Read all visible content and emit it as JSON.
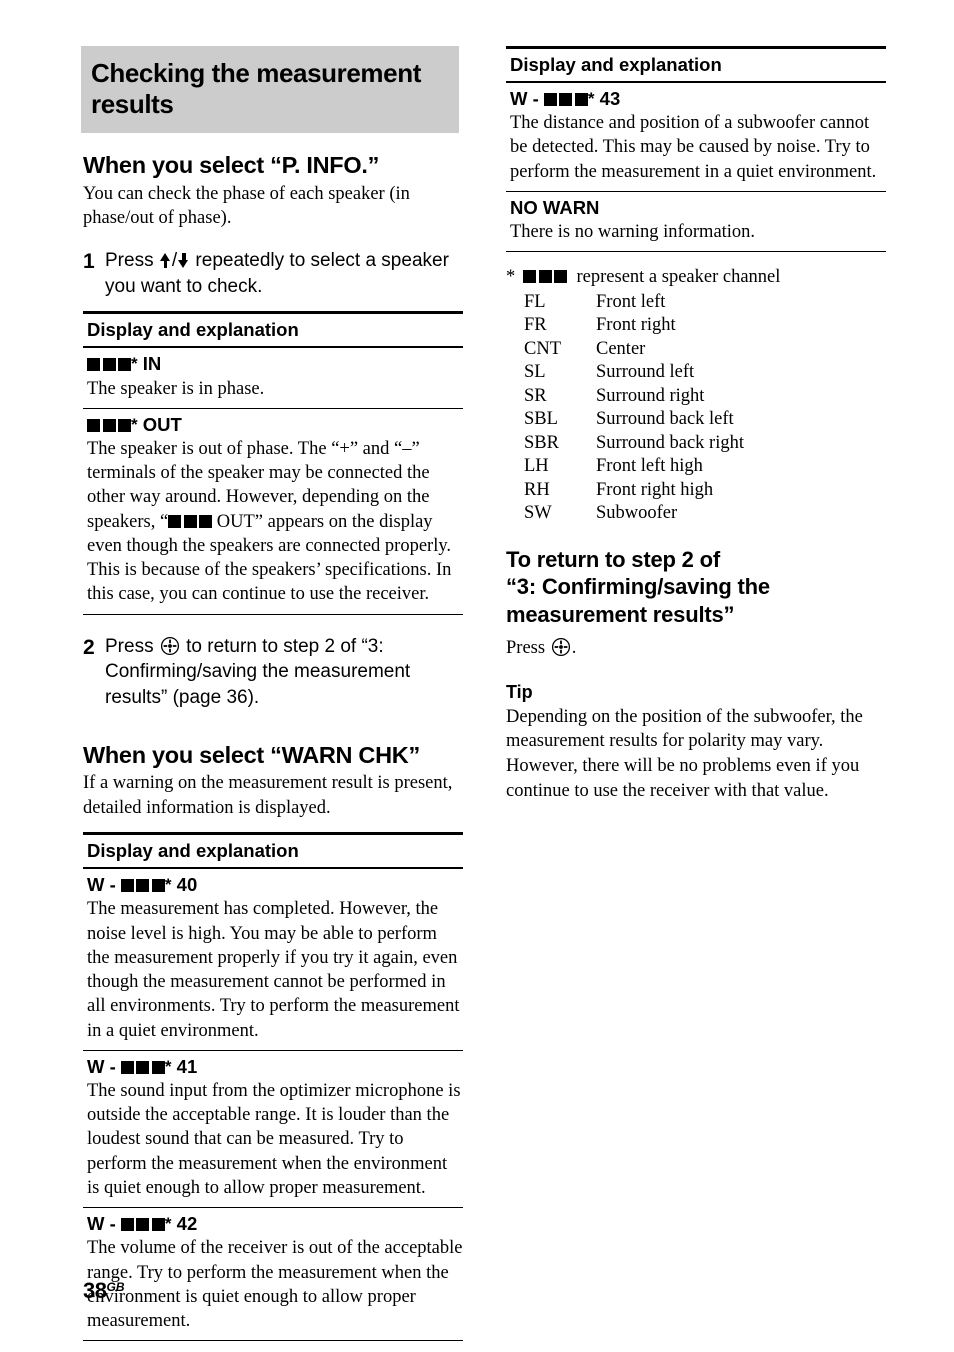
{
  "page": {
    "folio_number": "38",
    "folio_suffix": "GB"
  },
  "banner": {
    "title": "Checking the measurement results"
  },
  "left_column": {
    "section_pinfo": {
      "heading": "When you select “P. INFO.”",
      "intro": "You can check the phase of each speaker (in phase/out of phase).",
      "steps": [
        {
          "number": "1",
          "text_before": "Press ",
          "icon_1": "arrow-up-icon",
          "separator": "/",
          "icon_2": "arrow-down-icon",
          "text_after": " repeatedly to select a speaker you want to check."
        },
        {
          "number": "2",
          "text_before": "Press ",
          "icon_1": "enter-button-icon",
          "text_after": " to return to step 2 of “3: Confirming/saving the measurement results” (page 36)."
        }
      ],
      "table": {
        "header": "Display and explanation",
        "rows": [
          {
            "code_squares": 3,
            "code_star": "*",
            "code_suffix": "IN",
            "text": "The speaker is in phase."
          },
          {
            "code_squares": 3,
            "code_star": "*",
            "code_suffix": "OUT",
            "text_part_1": "The speaker is out of phase. The “+” and “–” terminals of the speaker may be connected the other way around. However, depending on the speakers, “",
            "inline_squares": 3,
            "text_part_2": " OUT” appears on the display even though the speakers are connected properly. This is because of the speakers’ specifications. In this case, you can continue to use the receiver."
          }
        ]
      }
    },
    "section_warnchk": {
      "heading": "When you select “WARN CHK”",
      "intro": "If a warning on the measurement result is present, detailed information is displayed.",
      "table": {
        "header": "Display and explanation",
        "rows": [
          {
            "code_prefix": "W - ",
            "code_squares": 3,
            "code_star": "*",
            "code_suffix": "40",
            "text": "The measurement has completed. However, the noise level is high. You may be able to perform the measurement properly if you try it again, even though the measurement cannot be performed in all environments. Try to perform the measurement in a quiet environment."
          },
          {
            "code_prefix": "W - ",
            "code_squares": 3,
            "code_star": "*",
            "code_suffix": "41",
            "text": "The sound input from the optimizer microphone is outside the acceptable range. It is louder than the loudest sound that can be measured. Try to perform the measurement when the environment is quiet enough to allow proper measurement."
          },
          {
            "code_prefix": "W - ",
            "code_squares": 3,
            "code_star": "*",
            "code_suffix": "42",
            "text": "The volume of the receiver is out of the acceptable range. Try to perform the measurement when the environment is quiet enough to allow proper measurement."
          }
        ]
      }
    }
  },
  "right_column": {
    "table": {
      "header": "Display and explanation",
      "rows": [
        {
          "code_prefix": "W - ",
          "code_squares": 3,
          "code_star": "*",
          "code_suffix": "43",
          "text": "The distance and position of a subwoofer cannot be detected. This may be caused by noise. Try to perform the measurement in a quiet environment."
        },
        {
          "code_prefix": "",
          "code_squares": 0,
          "code_star": "",
          "code_suffix": "NO WARN",
          "text": "There is no warning information."
        }
      ]
    },
    "legend": {
      "footnote_marker": "*",
      "footnote_squares": 3,
      "footnote_text": "represent a speaker channel",
      "channels": [
        {
          "abbr": "FL",
          "name": "Front left"
        },
        {
          "abbr": "FR",
          "name": "Front right"
        },
        {
          "abbr": "CNT",
          "name": "Center"
        },
        {
          "abbr": "SL",
          "name": "Surround left"
        },
        {
          "abbr": "SR",
          "name": "Surround right"
        },
        {
          "abbr": "SBL",
          "name": "Surround back left"
        },
        {
          "abbr": "SBR",
          "name": "Surround back right"
        },
        {
          "abbr": "LH",
          "name": "Front left high"
        },
        {
          "abbr": "RH",
          "name": "Front right high"
        },
        {
          "abbr": "SW",
          "name": "Subwoofer"
        }
      ]
    },
    "return_section": {
      "heading_line_1": "To return to step 2 of",
      "heading_line_2": "“3: Confirming/saving the",
      "heading_line_3": "measurement results”",
      "press_before": "Press ",
      "press_icon": "enter-button-icon",
      "press_after": "."
    },
    "tip": {
      "heading": "Tip",
      "text": "Depending on the position of the subwoofer, the measurement results for polarity may vary. However, there will be no problems even if you continue to use the receiver with that value."
    }
  },
  "colors": {
    "banner_background": "#cccccc",
    "text": "#000000",
    "rule": "#000000"
  }
}
